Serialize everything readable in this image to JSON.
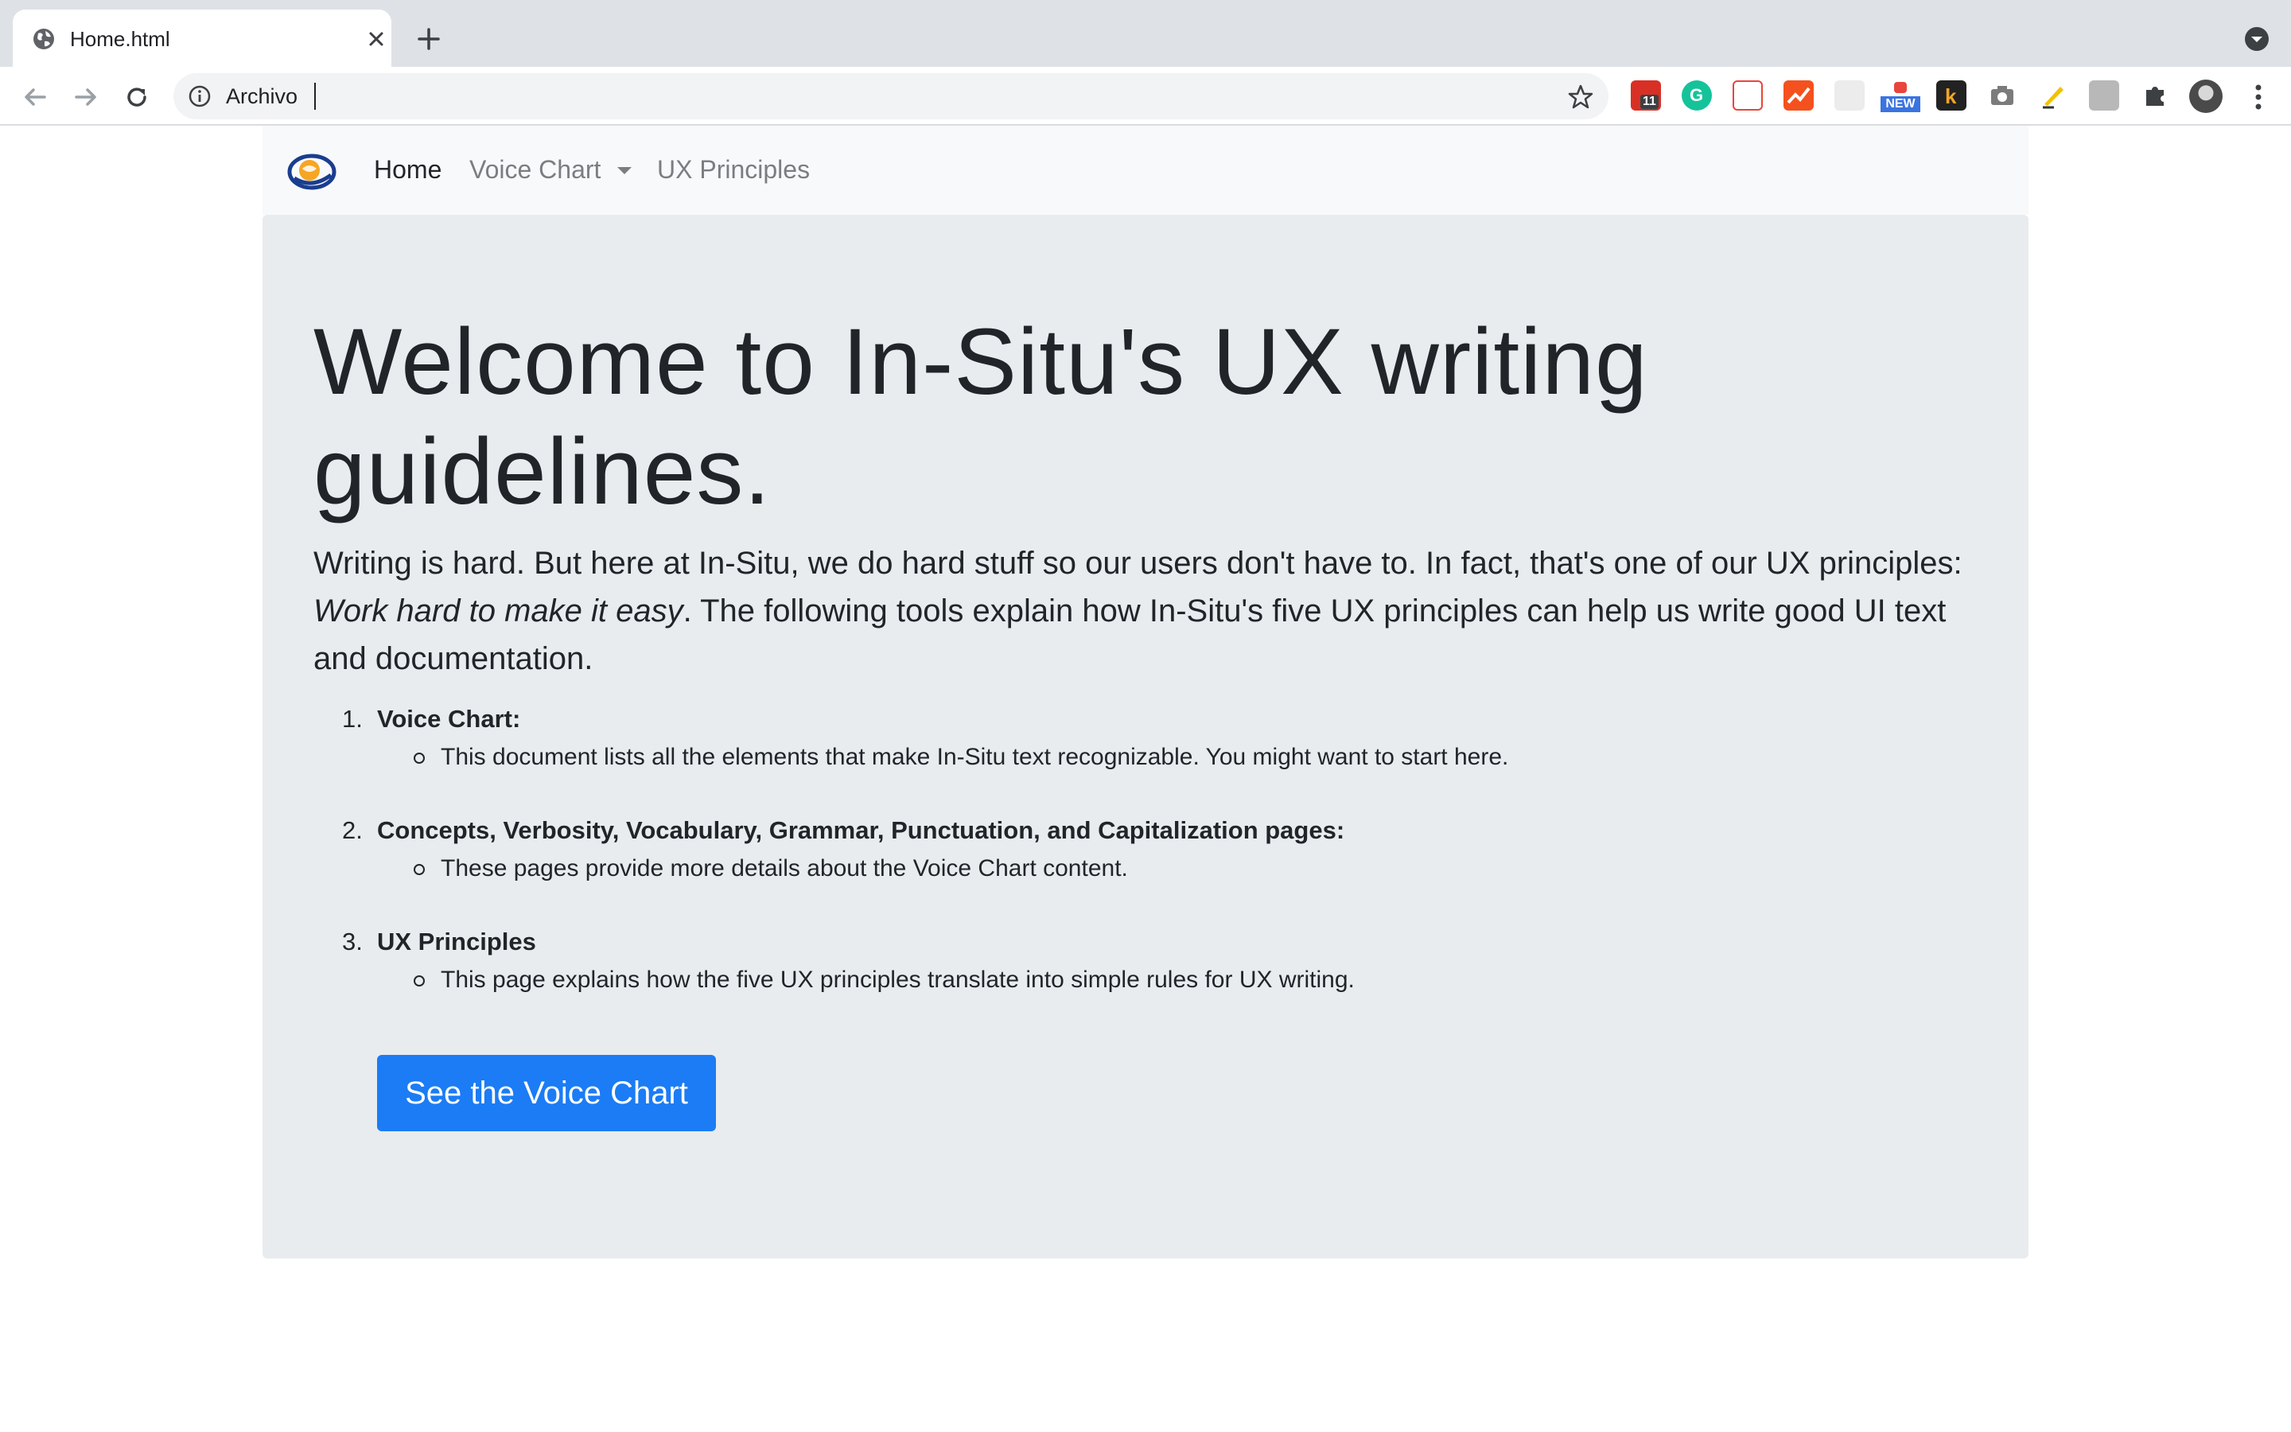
{
  "browser": {
    "tab_title": "Home.html",
    "address_text": "Archivo",
    "extensions": [
      {
        "name": "calendar-extension-icon",
        "badge": "11",
        "color": "#d93025"
      },
      {
        "name": "grammarly-extension-icon",
        "color": "#15c39a"
      },
      {
        "name": "pdf-extension-icon",
        "color": "#e8453c"
      },
      {
        "name": "analytics-extension-icon",
        "color": "#f4511e"
      },
      {
        "name": "react-devtools-extension-icon",
        "color": "#c9c9c9"
      },
      {
        "name": "new-extension-icon",
        "badge": "NEW",
        "color": "#3b73e0"
      },
      {
        "name": "k-extension-icon",
        "color": "#222222"
      },
      {
        "name": "camera-extension-icon",
        "color": "#7b7b7b"
      },
      {
        "name": "highlighter-extension-icon",
        "color": "#f2c200"
      },
      {
        "name": "grey-extension-icon",
        "color": "#b8b8b8"
      },
      {
        "name": "extensions-puzzle-icon",
        "color": "#5f6368"
      }
    ]
  },
  "navbar": {
    "links": [
      "Home",
      "Voice Chart",
      "UX Principles"
    ]
  },
  "hero": {
    "title": "Welcome to In-Situ's UX writing guidelines.",
    "lead_part1": "Writing is hard. But here at In-Situ, we do hard stuff so our users don't have to. In fact, that's one of our UX principles: ",
    "lead_emphasis": "Work hard to make it easy",
    "lead_part2": ". The following tools explain how In-Situ's five UX principles can help us write good UI text and documentation."
  },
  "steps": [
    {
      "number": "1.",
      "title": "Voice Chart:",
      "detail": "This document lists all the elements that make In-Situ text recognizable. You might want to start here."
    },
    {
      "number": "2.",
      "title": "Concepts, Verbosity, Vocabulary, Grammar, Punctuation, and Capitalization pages:",
      "detail": "These pages provide more details about the Voice Chart content."
    },
    {
      "number": "3.",
      "title": "UX Principles",
      "detail": "This page explains how the five UX principles translate into simple rules for UX writing."
    }
  ],
  "cta": {
    "label": "See the Voice Chart"
  },
  "colors": {
    "primary": "#1b7cf5",
    "jumbotron_bg": "#e9ecef",
    "navbar_bg": "#f8f9fa"
  }
}
